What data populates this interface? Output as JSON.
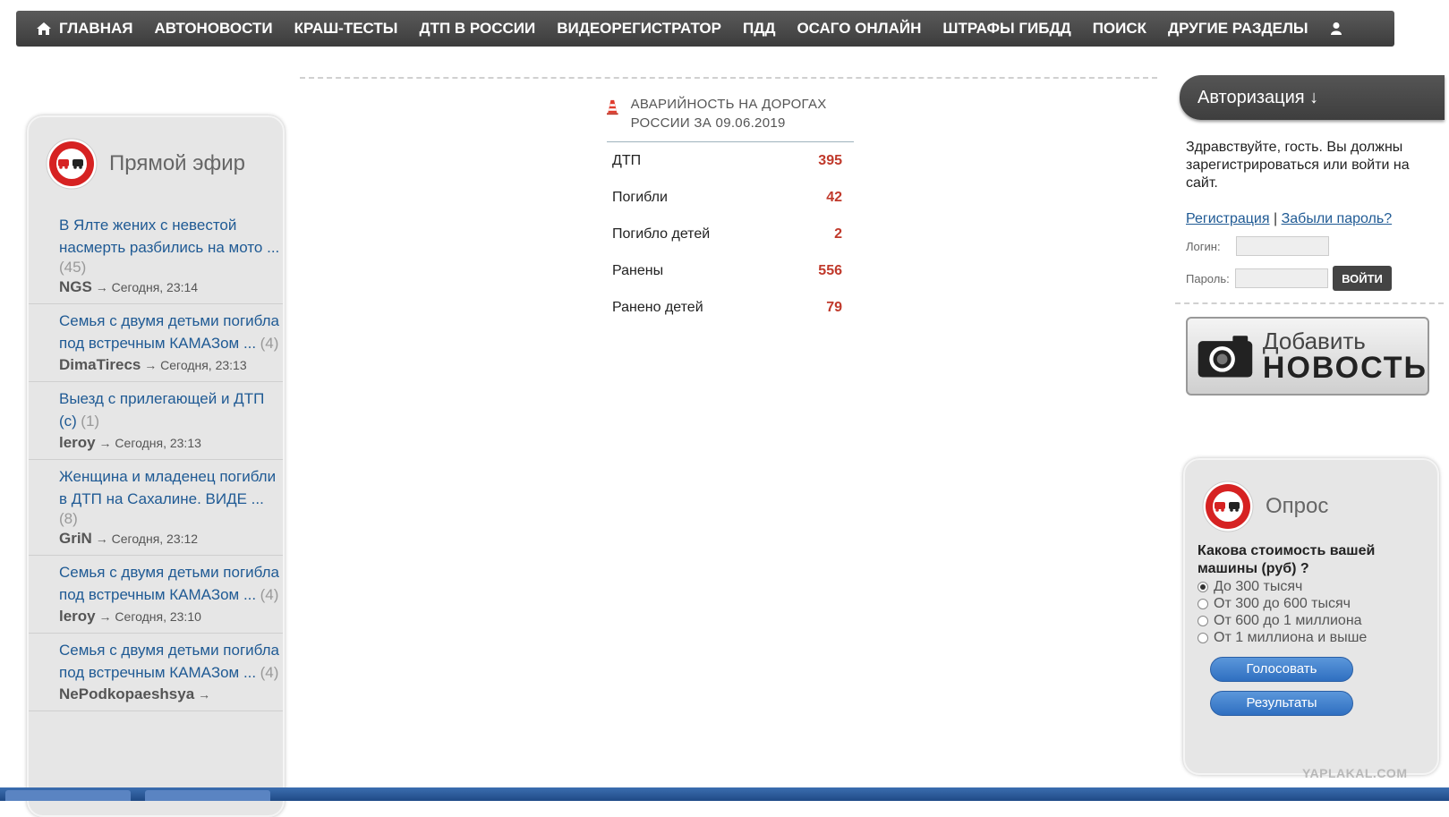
{
  "nav": {
    "items": [
      "ГЛАВНАЯ",
      "АВТОНОВОСТИ",
      "КРАШ-ТЕСТЫ",
      "ДТП В РОССИИ",
      "ВИДЕОРЕГИСТРАТОР",
      "ПДД",
      "ОСАГО ОНЛАЙН",
      "ШТРАФЫ ГИБДД",
      "ПОИСК",
      "ДРУГИЕ РАЗДЕЛЫ"
    ]
  },
  "live": {
    "title": "Прямой эфир",
    "items": [
      {
        "title": "В Ялте жених с невестой насмерть разбились на мото ...",
        "count": "(45)",
        "author": "NGS",
        "time": "→ Сегодня, 23:14"
      },
      {
        "title": "Семья с двумя детьми погибла под встречным КАМАЗом ...",
        "count": "(4)",
        "author": "DimaTirecs",
        "time": "→ Сегодня, 23:13"
      },
      {
        "title": "Выезд с прилегающей и ДТП (с)",
        "count": "(1)",
        "author": "leroy",
        "time": "→ Сегодня, 23:13"
      },
      {
        "title": "Женщина и младенец погибли в ДТП на Сахалине. ВИДЕ ...",
        "count": "(8)",
        "author": "GriN",
        "time": "→ Сегодня, 23:12"
      },
      {
        "title": "Семья с двумя детьми погибла под встречным КАМАЗом ...",
        "count": "(4)",
        "author": "leroy",
        "time": "→ Сегодня, 23:10"
      },
      {
        "title": "Семья с двумя детьми погибла под встречным КАМАЗом ...",
        "count": "(4)",
        "author": "NePodkopaeshsya",
        "time": "→"
      }
    ]
  },
  "stats": {
    "title": "АВАРИЙНОСТЬ НА ДОРОГАХ РОССИИ ЗА 09.06.2019",
    "rows": [
      {
        "label": "ДТП",
        "value": "395"
      },
      {
        "label": "Погибли",
        "value": "42"
      },
      {
        "label": "Погибло детей",
        "value": "2"
      },
      {
        "label": "Ранены",
        "value": "556"
      },
      {
        "label": "Ранено детей",
        "value": "79"
      }
    ]
  },
  "auth": {
    "title": "Авторизация ↓",
    "greeting": "Здравствуйте, гость. Вы должны зарегистрироваться или войти на сайт.",
    "register": "Регистрация",
    "separator": "|",
    "forgot": "Забыли пароль?",
    "login_label": "Логин:",
    "password_label": "Пароль:",
    "login_button": "ВОЙТИ"
  },
  "add_news": {
    "line1": "Добавить",
    "line2": "НОВОСТЬ"
  },
  "poll": {
    "title": "Опрос",
    "question": "Какова стоимость вашей машины (руб) ?",
    "options": [
      "До 300 тысяч",
      "От 300 до 600 тысяч",
      "От 600 до 1 миллиона",
      "От 1 миллиона и выше"
    ],
    "vote_button": "Голосовать",
    "results_button": "Результаты"
  },
  "watermark": "YAPLAKAL.COM",
  "colors": {
    "accent_red": "#c0392b",
    "link": "#1f5a94",
    "nav_bg": "#474747"
  }
}
